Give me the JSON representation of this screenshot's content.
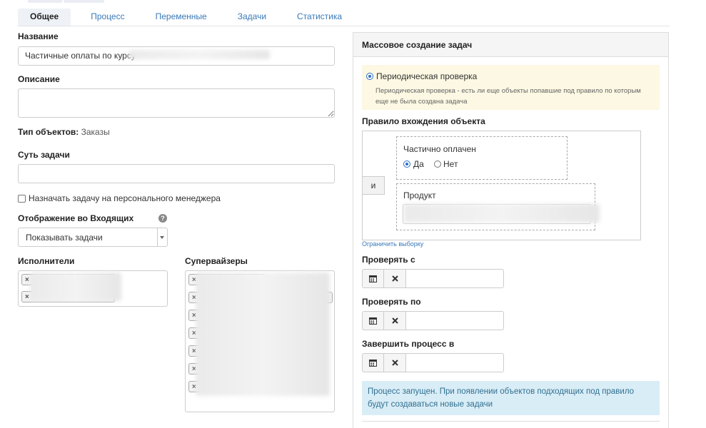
{
  "tabs": [
    {
      "label": "Общее",
      "active": true
    },
    {
      "label": "Процесс",
      "active": false
    },
    {
      "label": "Переменные",
      "active": false
    },
    {
      "label": "Задачи",
      "active": false
    },
    {
      "label": "Статистика",
      "active": false
    }
  ],
  "form": {
    "name_label": "Название",
    "name_value": "Частичные оплаты по курсу",
    "description_label": "Описание",
    "description_value": "",
    "object_type_label": "Тип объектов:",
    "object_type_value": "Заказы",
    "essence_label": "Суть задачи",
    "essence_value": "",
    "assign_manager_label": "Назначать задачу на персонального менеджера",
    "assign_manager_checked": false,
    "inbox_display_label": "Отображение во Входящих",
    "inbox_display_value": "Показывать задачи",
    "help_icon": "question-circle-icon",
    "executors_label": "Исполнители",
    "supervisors_label": "Супервайзеры",
    "chip_remove_glyph": "×"
  },
  "panel": {
    "title": "Массовое создание задач",
    "periodic_check_label": "Периодическая проверка",
    "periodic_check_desc": "Периодическая проверка - есть ли еще объекты попавшие под правило по которым еще не была создана задача",
    "rule_label": "Правило вхождения объекта",
    "and_button": "и",
    "condition_paid_title": "Частично оплачен",
    "yes_label": "Да",
    "no_label": "Нет",
    "paid_value": "yes",
    "product_label": "Продукт",
    "limit_link": "Ограничить выборку",
    "check_from_label": "Проверять с",
    "check_to_label": "Проверять по",
    "finish_label": "Завершить процесс в",
    "calendar_icon": "calendar-icon",
    "clear_icon": "times-icon",
    "info_text": "Процесс запущен. При появлении объектов подходящих под правило будут создаваться новые задачи"
  },
  "colors": {
    "link": "#3a79b8",
    "warning_bg": "#fcf8e3",
    "info_bg": "#d9edf7",
    "info_text": "#31708f"
  }
}
